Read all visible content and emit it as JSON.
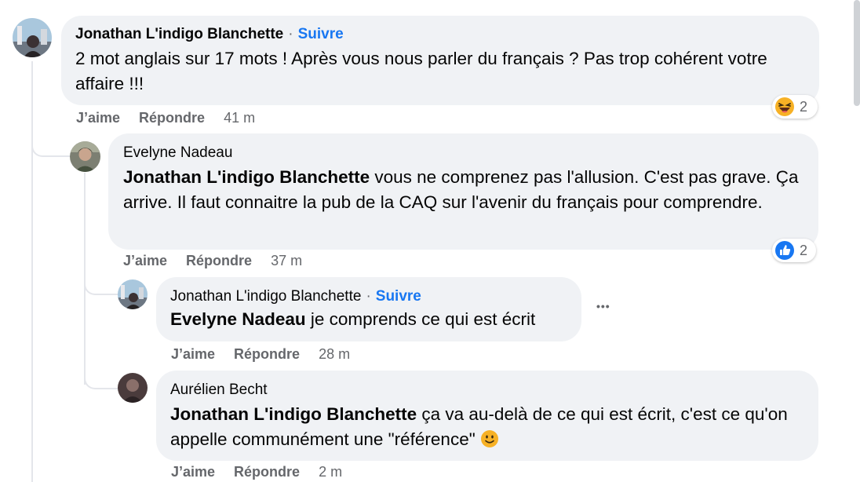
{
  "comments": [
    {
      "author": "Jonathan L'indigo Blanchette",
      "separator": "·",
      "follow_label": "Suivre",
      "text": "2 mot anglais sur 17 mots ! Après vous nous parler du français ? Pas trop cohérent votre affaire !!!",
      "like_label": "J’aime",
      "reply_label": "Répondre",
      "time": "41 m",
      "reaction": {
        "type": "laugh",
        "icon": "laugh-reaction-icon",
        "count": "2"
      }
    },
    {
      "author": "Evelyne Nadeau",
      "mention": "Jonathan L'indigo Blanchette",
      "text": " vous ne comprenez pas l'allusion. C'est pas grave. Ça arrive. Il faut connaitre la pub de la CAQ sur l'avenir du français pour comprendre.",
      "like_label": "J’aime",
      "reply_label": "Répondre",
      "time": "37 m",
      "reaction": {
        "type": "like",
        "icon": "like-reaction-icon",
        "count": "2"
      }
    },
    {
      "author": "Jonathan L'indigo Blanchette",
      "separator": "·",
      "follow_label": "Suivre",
      "mention": "Evelyne Nadeau",
      "text": " je comprends ce qui est écrit",
      "more_label": "•••",
      "like_label": "J’aime",
      "reply_label": "Répondre",
      "time": "28 m"
    },
    {
      "author": "Aurélien Becht",
      "mention": "Jonathan L'indigo Blanchette",
      "text": " ça va au-delà de ce qui est écrit, c'est ce qu'on appelle communément une \"référence\" ",
      "emoji": "🙂",
      "like_label": "J’aime",
      "reply_label": "Répondre",
      "time": "2 m"
    }
  ],
  "colors": {
    "bubble": "#f0f2f5",
    "link": "#1877f2",
    "muted": "#65676b",
    "line": "#e4e6eb",
    "like_blue": "#1877f2",
    "laugh_yellow": "#f7b125"
  }
}
